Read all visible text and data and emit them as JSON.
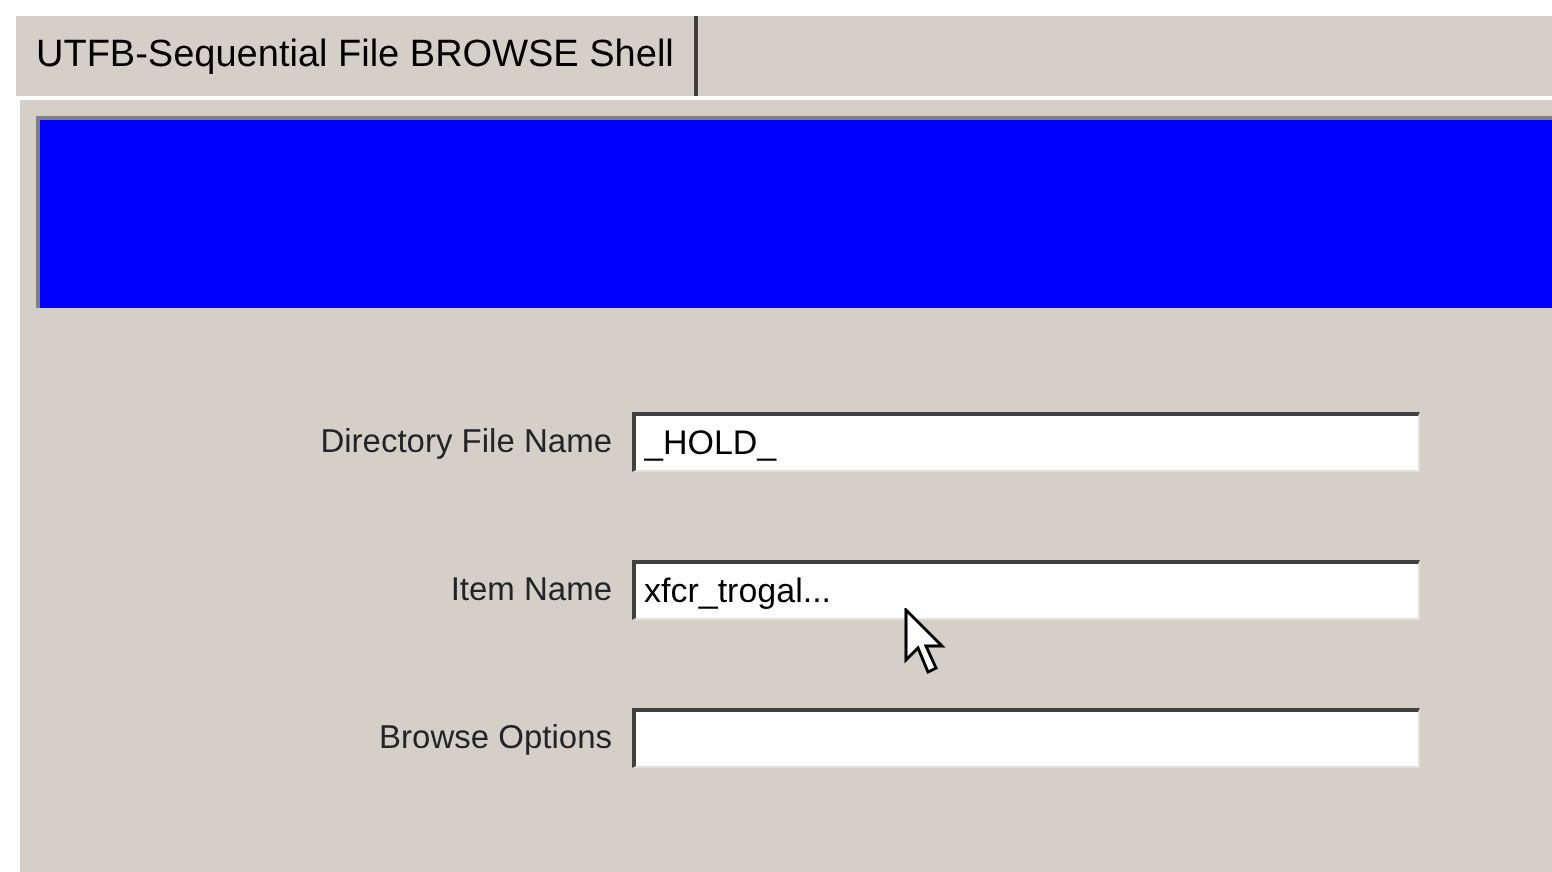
{
  "tabs": [
    {
      "label": "UTFB-Sequential File BROWSE Shell",
      "selected": true
    }
  ],
  "fields": [
    {
      "label": "Directory File Name",
      "value": "_HOLD_"
    },
    {
      "label": "Item Name",
      "value": "xfcr_trogal..."
    },
    {
      "label": "Browse Options"
    }
  ]
}
